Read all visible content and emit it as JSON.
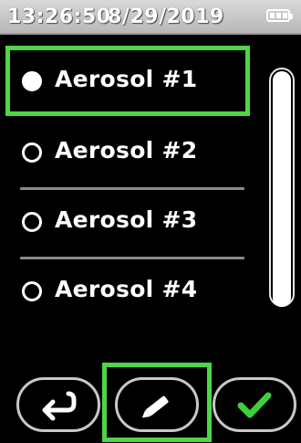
{
  "status": {
    "time": "13:26:50",
    "date": "8/29/2019",
    "battery_icon": "battery-full-icon"
  },
  "list": {
    "items": [
      {
        "label": "Aerosol #1",
        "selected": true
      },
      {
        "label": "Aerosol #2",
        "selected": false
      },
      {
        "label": "Aerosol #3",
        "selected": false
      },
      {
        "label": "Aerosol #4",
        "selected": false
      }
    ]
  },
  "toolbar": {
    "back_icon": "return-arrow-icon",
    "edit_icon": "pencil-icon",
    "confirm_icon": "checkmark-icon"
  },
  "colors": {
    "highlight": "#4dd646",
    "confirm": "#3ecf3a",
    "background": "#000000",
    "status_bar": "#c8c8c8"
  }
}
